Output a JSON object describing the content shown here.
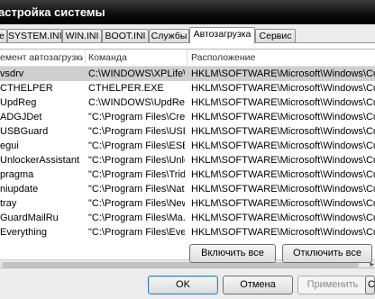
{
  "window": {
    "title": "астройка системы"
  },
  "tabs": [
    {
      "label": "е"
    },
    {
      "label": "SYSTEM.INI"
    },
    {
      "label": "WIN.INI"
    },
    {
      "label": "BOOT.INI"
    },
    {
      "label": "Службы"
    },
    {
      "label": "Автозагрузка"
    },
    {
      "label": "Сервис"
    }
  ],
  "table": {
    "columns": [
      "емент автозагрузки",
      "Команда",
      "Расположение"
    ],
    "rows": [
      {
        "name": "vsdrv",
        "command": "C:\\WINDOWS\\XPLife\\...",
        "location": "HKLM\\SOFTWARE\\Microsoft\\Windows\\CurrentVe"
      },
      {
        "name": "CTHELPER",
        "command": "CTHELPER.EXE",
        "location": "HKLM\\SOFTWARE\\Microsoft\\Windows\\CurrentVe"
      },
      {
        "name": "UpdReg",
        "command": "C:\\WINDOWS\\UpdRe...",
        "location": "HKLM\\SOFTWARE\\Microsoft\\Windows\\CurrentVe"
      },
      {
        "name": "ADGJDet",
        "command": "\"C:\\Program Files\\Cre...",
        "location": "HKLM\\SOFTWARE\\Microsoft\\Windows\\CurrentVe"
      },
      {
        "name": "USBGuard",
        "command": "\"C:\\Program Files\\USB...",
        "location": "HKLM\\SOFTWARE\\Microsoft\\Windows\\CurrentVe"
      },
      {
        "name": "egui",
        "command": "\"C:\\Program Files\\ESE...",
        "location": "HKLM\\SOFTWARE\\Microsoft\\Windows\\CurrentVe"
      },
      {
        "name": "UnlockerAssistant",
        "command": "\"C:\\Program Files\\Unlo...",
        "location": "HKLM\\SOFTWARE\\Microsoft\\Windows\\CurrentVe"
      },
      {
        "name": "pragma",
        "command": "\"C:\\Program Files\\Tride...",
        "location": "HKLM\\SOFTWARE\\Microsoft\\Windows\\CurrentVe"
      },
      {
        "name": "niupdate",
        "command": "\"C:\\Program Files\\Natio...",
        "location": "HKLM\\SOFTWARE\\Microsoft\\Windows\\CurrentVe"
      },
      {
        "name": "tray",
        "command": "\"C:\\Program Files\\New...",
        "location": "HKLM\\SOFTWARE\\Microsoft\\Windows\\CurrentVe"
      },
      {
        "name": "GuardMailRu",
        "command": "\"C:\\Program Files\\Ma...",
        "location": "HKLM\\SOFTWARE\\Microsoft\\Windows\\CurrentVe"
      },
      {
        "name": "Everything",
        "command": "\"C:\\Program Files\\Eve...",
        "location": "HKLM\\SOFTWARE\\Microsoft\\Windows\\CurrentVe"
      }
    ]
  },
  "buttons": {
    "enable_all": "Включить все",
    "disable_all": "Отключить все",
    "ok": "OK",
    "cancel": "Отмена",
    "apply": "Применить",
    "help": "Спра"
  }
}
